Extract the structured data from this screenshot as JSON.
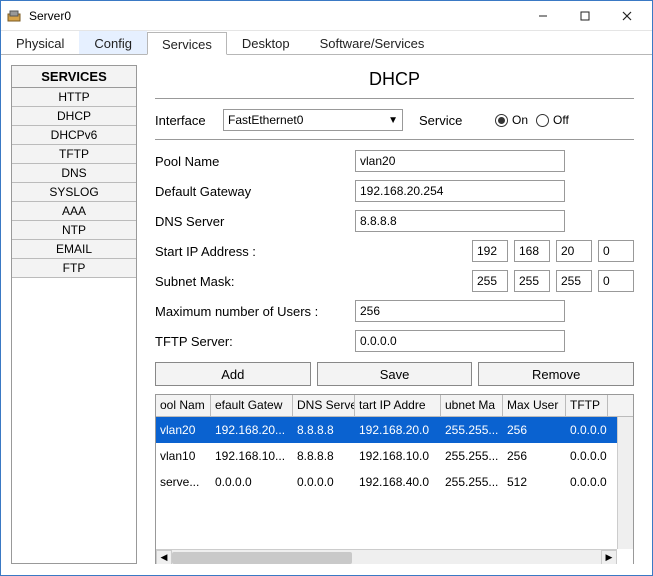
{
  "window": {
    "title": "Server0"
  },
  "tabs": [
    {
      "label": "Physical"
    },
    {
      "label": "Config"
    },
    {
      "label": "Services"
    },
    {
      "label": "Desktop"
    },
    {
      "label": "Software/Services"
    }
  ],
  "sidebar": {
    "header": "SERVICES",
    "items": [
      "HTTP",
      "DHCP",
      "DHCPv6",
      "TFTP",
      "DNS",
      "SYSLOG",
      "AAA",
      "NTP",
      "EMAIL",
      "FTP"
    ]
  },
  "panel": {
    "title": "DHCP",
    "interface_label": "Interface",
    "interface_value": "FastEthernet0",
    "service_label": "Service",
    "on_label": "On",
    "off_label": "Off",
    "pool_name_label": "Pool Name",
    "pool_name_value": "vlan20",
    "gateway_label": "Default Gateway",
    "gateway_value": "192.168.20.254",
    "dns_label": "DNS Server",
    "dns_value": "8.8.8.8",
    "start_ip_label": "Start IP Address :",
    "start_ip": [
      "192",
      "168",
      "20",
      "0"
    ],
    "subnet_label": "Subnet Mask:",
    "subnet": [
      "255",
      "255",
      "255",
      "0"
    ],
    "max_users_label": "Maximum number of Users :",
    "max_users_value": "256",
    "tftp_label": "TFTP Server:",
    "tftp_value": "0.0.0.0",
    "add_label": "Add",
    "save_label": "Save",
    "remove_label": "Remove"
  },
  "table": {
    "headers": [
      "ool Nam",
      "efault Gatew",
      "DNS Serve",
      "tart IP Addre",
      "ubnet Ma",
      "Max User",
      "TFTP"
    ],
    "rows": [
      {
        "pool": "vlan20",
        "gw": "192.168.20...",
        "dns": "8.8.8.8",
        "start": "192.168.20.0",
        "mask": "255.255...",
        "max": "256",
        "tftp": "0.0.0.0",
        "selected": true
      },
      {
        "pool": "vlan10",
        "gw": "192.168.10...",
        "dns": "8.8.8.8",
        "start": "192.168.10.0",
        "mask": "255.255...",
        "max": "256",
        "tftp": "0.0.0.0",
        "selected": false
      },
      {
        "pool": "serve...",
        "gw": "0.0.0.0",
        "dns": "0.0.0.0",
        "start": "192.168.40.0",
        "mask": "255.255...",
        "max": "512",
        "tftp": "0.0.0.0",
        "selected": false
      }
    ]
  }
}
